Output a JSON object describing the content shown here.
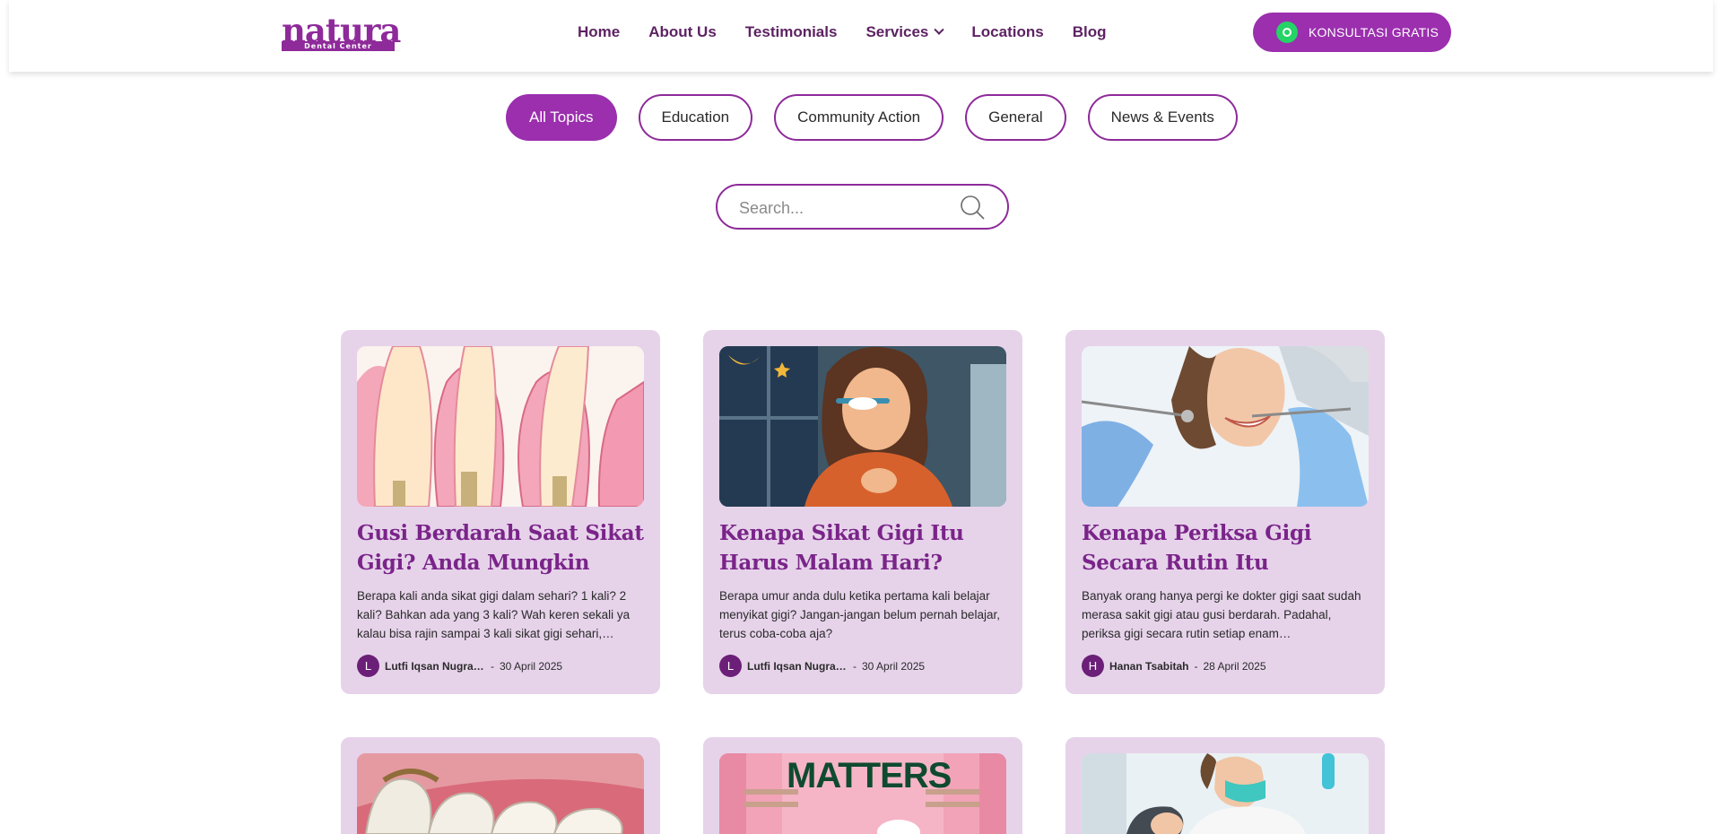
{
  "logo": {
    "word": "natura",
    "sub": "Dental Center"
  },
  "nav": [
    {
      "label": "Home"
    },
    {
      "label": "About Us"
    },
    {
      "label": "Testimonials"
    },
    {
      "label": "Services"
    },
    {
      "label": "Locations"
    },
    {
      "label": "Blog"
    }
  ],
  "cta": {
    "label": "KONSULTASI GRATIS"
  },
  "topics": [
    {
      "label": "All Topics",
      "active": true
    },
    {
      "label": "Education"
    },
    {
      "label": "Community Action"
    },
    {
      "label": "General"
    },
    {
      "label": "News & Events"
    }
  ],
  "search": {
    "placeholder": "Search..."
  },
  "posts": [
    {
      "title": "Gusi Berdarah Saat Sikat Gigi? Anda Mungkin Mengalami…",
      "excerpt": "Berapa kali anda sikat gigi dalam sehari? 1 kali? 2 kali? Bahkan ada yang 3 kali? Wah keren sekali ya kalau bisa rajin sampai 3 kali sikat gigi sehari,…",
      "author_initial": "L",
      "author": "Lutfi Iqsan Nugrah...",
      "date": "30 April 2025"
    },
    {
      "title": "Kenapa Sikat Gigi Itu Harus Malam Hari? Faedahnya Apa…",
      "excerpt": "Berapa umur anda dulu ketika pertama kali belajar menyikat gigi? Jangan-jangan belum pernah belajar, terus coba-coba aja?",
      "author_initial": "L",
      "author": "Lutfi Iqsan Nugrah...",
      "date": "30 April 2025"
    },
    {
      "title": "Kenapa Periksa Gigi Secara Rutin Itu Penting?",
      "excerpt": "Banyak orang hanya pergi ke dokter gigi saat sudah merasa sakit gigi atau gusi berdarah. Padahal, periksa gigi secara rutin setiap enam…",
      "author_initial": "H",
      "author": "Hanan Tsabitah",
      "date": "28 April 2025"
    }
  ],
  "row2": {
    "poster_text": "MATTERS"
  },
  "colors": {
    "brand": "#9b2fae",
    "card": "#e6d3ea",
    "title": "#7a2489"
  }
}
